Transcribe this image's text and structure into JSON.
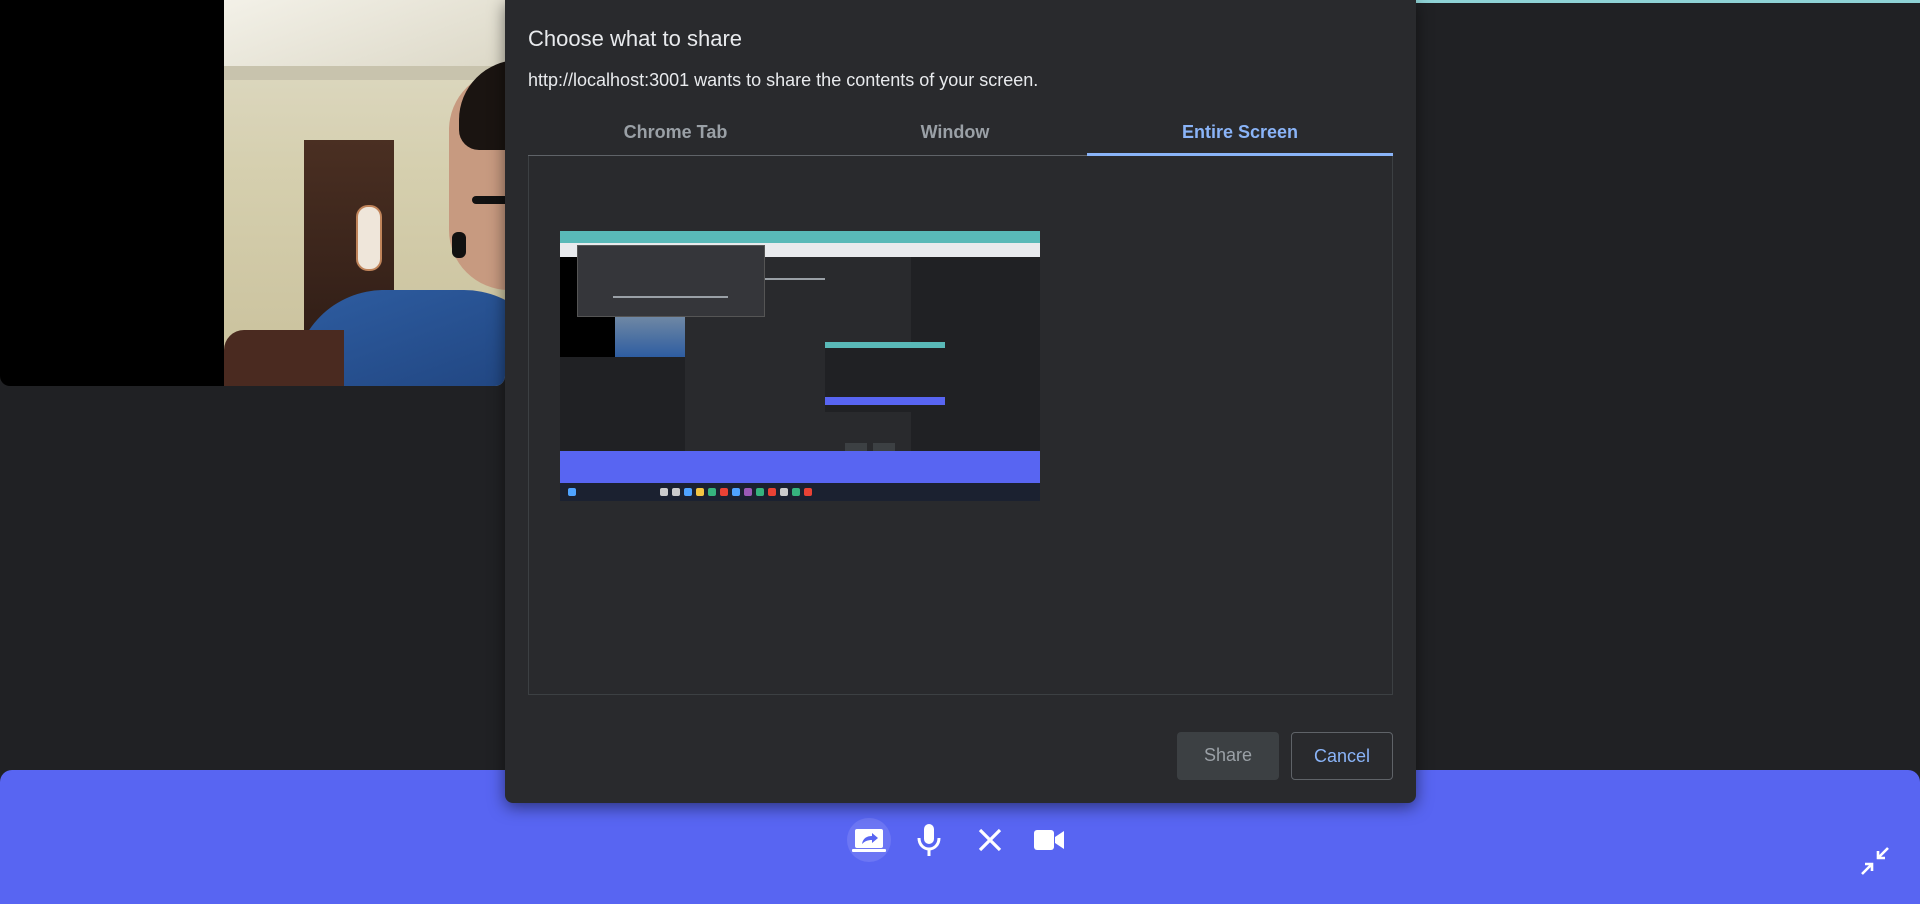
{
  "dialog": {
    "title": "Choose what to share",
    "subtitle": "http://localhost:3001 wants to share the contents of your screen.",
    "tabs": [
      {
        "label": "Chrome Tab",
        "selected": false
      },
      {
        "label": "Window",
        "selected": false
      },
      {
        "label": "Entire Screen",
        "selected": true
      }
    ],
    "share_label": "Share",
    "cancel_label": "Cancel"
  },
  "controls": {
    "icons": [
      "screen-share-icon",
      "microphone-icon",
      "close-icon",
      "video-camera-icon"
    ],
    "minimize_icon": "minimize-icon"
  },
  "colors": {
    "accent": "#8ab4f8",
    "control_bar": "#5865f2",
    "dialog_bg": "#292a2d",
    "page_bg": "#202124"
  }
}
